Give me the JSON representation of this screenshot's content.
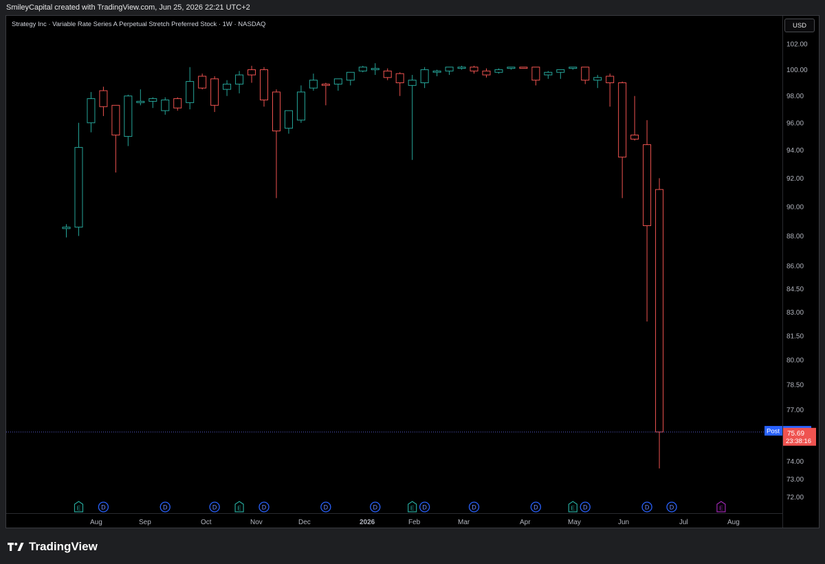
{
  "header": {
    "credit": "SmileyCapital created with TradingView.com, Jun 25, 2026 22:21 UTC+2"
  },
  "symbol_title": "Strategy Inc · Variable Rate Series A Perpetual Stretch Preferred Stock · 1W · NASDAQ",
  "currency_button": "USD",
  "branding": {
    "text": "TradingView",
    "logo_icon": "tradingview-logo-icon"
  },
  "colors": {
    "up": "#26a69a",
    "down": "#ef5350",
    "background": "#000000",
    "frame": "#1e1f22",
    "post_label": "#2962ff",
    "dividend_marker": "#2962ff",
    "earnings_marker_future": "#9c27b0"
  },
  "chart_data": {
    "type": "candlestick",
    "title": "Strategy Inc · Variable Rate Series A Perpetual Stretch Preferred Stock · 1W · NASDAQ",
    "interval": "1W",
    "currency": "USD",
    "y_scale": "log",
    "ylim": [
      71.6,
      103.3
    ],
    "y_ticks": [
      "102.00",
      "100.00",
      "98.00",
      "96.00",
      "94.00",
      "92.00",
      "90.00",
      "88.00",
      "86.00",
      "84.50",
      "83.00",
      "81.50",
      "80.00",
      "78.50",
      "77.00",
      "74.00",
      "73.00",
      "72.00"
    ],
    "x_tick_labels": [
      "Aug",
      "Sep",
      "Oct",
      "Nov",
      "Dec",
      "2026",
      "Feb",
      "Mar",
      "Apr",
      "May",
      "Jun",
      "Jul",
      "Aug"
    ],
    "grid": false,
    "candles": [
      {
        "o": 88.5,
        "h": 88.8,
        "l": 87.9,
        "c": 88.6
      },
      {
        "o": 88.6,
        "h": 96.0,
        "l": 88.0,
        "c": 94.2
      },
      {
        "o": 96.0,
        "h": 98.3,
        "l": 95.3,
        "c": 97.8
      },
      {
        "o": 98.4,
        "h": 98.7,
        "l": 96.5,
        "c": 97.2
      },
      {
        "o": 97.3,
        "h": 97.3,
        "l": 92.4,
        "c": 95.1
      },
      {
        "o": 95.0,
        "h": 98.1,
        "l": 94.3,
        "c": 98.0
      },
      {
        "o": 97.5,
        "h": 98.5,
        "l": 97.3,
        "c": 97.6
      },
      {
        "o": 97.6,
        "h": 97.9,
        "l": 97.1,
        "c": 97.8
      },
      {
        "o": 96.9,
        "h": 97.9,
        "l": 96.6,
        "c": 97.7
      },
      {
        "o": 97.8,
        "h": 97.9,
        "l": 96.9,
        "c": 97.1
      },
      {
        "o": 97.5,
        "h": 100.2,
        "l": 97.0,
        "c": 99.1
      },
      {
        "o": 99.5,
        "h": 99.7,
        "l": 98.5,
        "c": 98.6
      },
      {
        "o": 99.3,
        "h": 99.5,
        "l": 96.8,
        "c": 97.3
      },
      {
        "o": 98.5,
        "h": 99.2,
        "l": 98.0,
        "c": 98.9
      },
      {
        "o": 98.9,
        "h": 99.9,
        "l": 98.2,
        "c": 99.6
      },
      {
        "o": 100.0,
        "h": 100.3,
        "l": 99.0,
        "c": 99.6
      },
      {
        "o": 100.0,
        "h": 100.2,
        "l": 97.2,
        "c": 97.7
      },
      {
        "o": 98.3,
        "h": 98.5,
        "l": 90.6,
        "c": 95.4
      },
      {
        "o": 95.6,
        "h": 96.9,
        "l": 95.2,
        "c": 96.9
      },
      {
        "o": 96.2,
        "h": 98.8,
        "l": 96.0,
        "c": 98.3
      },
      {
        "o": 98.6,
        "h": 99.7,
        "l": 98.4,
        "c": 99.2
      },
      {
        "o": 98.9,
        "h": 99.0,
        "l": 97.3,
        "c": 98.8
      },
      {
        "o": 98.9,
        "h": 99.3,
        "l": 98.4,
        "c": 99.3
      },
      {
        "o": 99.2,
        "h": 99.8,
        "l": 98.8,
        "c": 99.8
      },
      {
        "o": 99.9,
        "h": 100.3,
        "l": 99.8,
        "c": 100.2
      },
      {
        "o": 100.0,
        "h": 100.5,
        "l": 99.6,
        "c": 100.1
      },
      {
        "o": 99.9,
        "h": 100.1,
        "l": 99.2,
        "c": 99.4
      },
      {
        "o": 99.7,
        "h": 99.8,
        "l": 98.0,
        "c": 99.0
      },
      {
        "o": 98.8,
        "h": 99.6,
        "l": 93.3,
        "c": 99.2
      },
      {
        "o": 99.0,
        "h": 100.2,
        "l": 98.6,
        "c": 100.0
      },
      {
        "o": 99.8,
        "h": 100.0,
        "l": 99.5,
        "c": 99.9
      },
      {
        "o": 99.9,
        "h": 100.2,
        "l": 99.6,
        "c": 100.2
      },
      {
        "o": 100.1,
        "h": 100.3,
        "l": 100.0,
        "c": 100.2
      },
      {
        "o": 100.2,
        "h": 100.3,
        "l": 99.7,
        "c": 99.9
      },
      {
        "o": 99.9,
        "h": 100.1,
        "l": 99.4,
        "c": 99.6
      },
      {
        "o": 99.8,
        "h": 100.1,
        "l": 99.7,
        "c": 100.0
      },
      {
        "o": 100.1,
        "h": 100.2,
        "l": 100.0,
        "c": 100.2
      },
      {
        "o": 100.2,
        "h": 100.2,
        "l": 100.1,
        "c": 100.1
      },
      {
        "o": 100.2,
        "h": 100.2,
        "l": 98.8,
        "c": 99.2
      },
      {
        "o": 99.6,
        "h": 99.9,
        "l": 99.3,
        "c": 99.8
      },
      {
        "o": 99.8,
        "h": 100.0,
        "l": 99.3,
        "c": 100.0
      },
      {
        "o": 100.1,
        "h": 100.2,
        "l": 100.0,
        "c": 100.2
      },
      {
        "o": 100.2,
        "h": 100.2,
        "l": 98.9,
        "c": 99.2
      },
      {
        "o": 99.2,
        "h": 99.6,
        "l": 98.6,
        "c": 99.4
      },
      {
        "o": 99.5,
        "h": 99.7,
        "l": 97.2,
        "c": 99.0
      },
      {
        "o": 99.0,
        "h": 99.1,
        "l": 90.6,
        "c": 93.5
      },
      {
        "o": 95.1,
        "h": 98.0,
        "l": 94.7,
        "c": 94.8
      },
      {
        "o": 94.4,
        "h": 96.2,
        "l": 82.4,
        "c": 88.7
      },
      {
        "o": 91.2,
        "h": 92.0,
        "l": 73.6,
        "c": 75.69
      }
    ],
    "events": [
      {
        "type": "E",
        "candle": 1,
        "upcoming": false
      },
      {
        "type": "D",
        "candle": 3,
        "upcoming": false
      },
      {
        "type": "D",
        "candle": 8,
        "upcoming": false
      },
      {
        "type": "D",
        "candle": 12,
        "upcoming": false
      },
      {
        "type": "E",
        "candle": 14,
        "upcoming": false
      },
      {
        "type": "D",
        "candle": 16,
        "upcoming": false
      },
      {
        "type": "D",
        "candle": 21,
        "upcoming": false
      },
      {
        "type": "D",
        "candle": 25,
        "upcoming": false
      },
      {
        "type": "E",
        "candle": 28,
        "upcoming": false
      },
      {
        "type": "D",
        "candle": 29,
        "upcoming": false
      },
      {
        "type": "D",
        "candle": 33,
        "upcoming": false
      },
      {
        "type": "D",
        "candle": 38,
        "upcoming": false
      },
      {
        "type": "E",
        "candle": 41,
        "upcoming": false
      },
      {
        "type": "D",
        "candle": 42,
        "upcoming": false
      },
      {
        "type": "D",
        "candle": 47,
        "upcoming": false
      },
      {
        "type": "D",
        "candle": 49,
        "upcoming": true
      },
      {
        "type": "E",
        "candle": 53,
        "upcoming": true
      }
    ],
    "event_glyphs": {
      "E": "E",
      "D": "D"
    },
    "post_market": {
      "label": "Post",
      "value": "75.76",
      "price": 75.76
    },
    "last_price": {
      "value": "75.69",
      "countdown": "23:38:16",
      "price": 75.69
    }
  }
}
